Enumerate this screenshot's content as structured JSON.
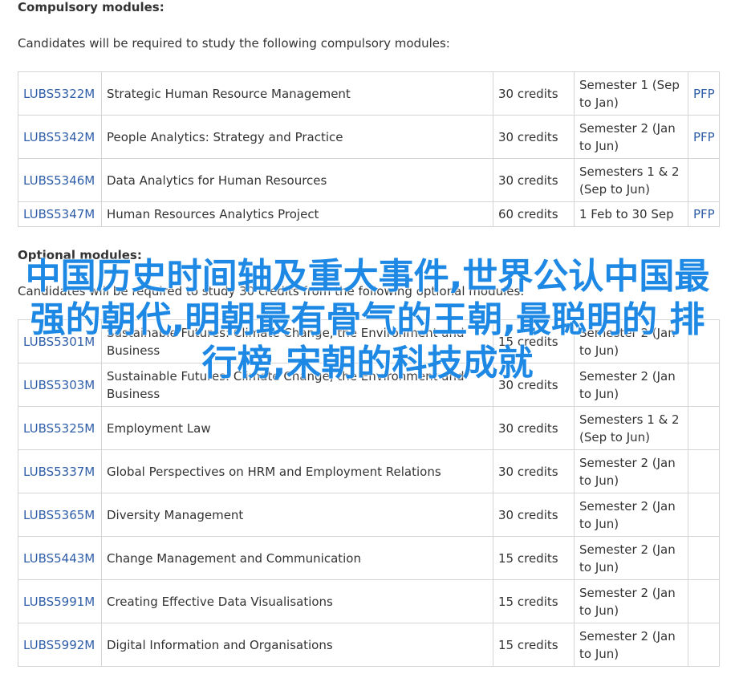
{
  "compulsory": {
    "heading": "Compulsory modules:",
    "intro": "Candidates will be required to study the following compulsory modules:",
    "rows": [
      {
        "code": "LUBS5322M",
        "title": "Strategic Human Resource Management",
        "credits": "30 credits",
        "semester": "Semester 1 (Sep to Jan)",
        "pfp": "PFP"
      },
      {
        "code": "LUBS5342M",
        "title": "People Analytics: Strategy and Practice",
        "credits": "30 credits",
        "semester": "Semester 2 (Jan to Jun)",
        "pfp": "PFP"
      },
      {
        "code": "LUBS5346M",
        "title": "Data Analytics for Human Resources",
        "credits": "30 credits",
        "semester": "Semesters 1 & 2 (Sep to Jun)",
        "pfp": ""
      },
      {
        "code": "LUBS5347M",
        "title": "Human Resources Analytics Project",
        "credits": "60 credits",
        "semester": "1 Feb to 30 Sep",
        "pfp": "PFP"
      }
    ]
  },
  "optional": {
    "heading": "Optional modules:",
    "intro": "Candidates will be required to study 30 credits from the following optional modules:",
    "rows": [
      {
        "code": "LUBS5301M",
        "title": "Sustainable Futures: Climate Change, the Environment and Business",
        "credits": "15 credits",
        "semester": "Semester 2 (Jan to Jun)"
      },
      {
        "code": "LUBS5303M",
        "title": "Sustainable Futures: Climate Change, the Environment and Business",
        "credits": "30 credits",
        "semester": "Semester 2 (Jan to Jun)"
      },
      {
        "code": "LUBS5325M",
        "title": "Employment Law",
        "credits": "30 credits",
        "semester": "Semesters 1 & 2 (Sep to Jun)"
      },
      {
        "code": "LUBS5337M",
        "title": "Global Perspectives on HRM and Employment Relations",
        "credits": "30 credits",
        "semester": "Semester 2 (Jan to Jun)"
      },
      {
        "code": "LUBS5365M",
        "title": "Diversity Management",
        "credits": "30 credits",
        "semester": "Semester 2 (Jan to Jun)"
      },
      {
        "code": "LUBS5443M",
        "title": "Change Management and Communication",
        "credits": "15 credits",
        "semester": "Semester 2 (Jan to Jun)"
      },
      {
        "code": "LUBS5991M",
        "title": "Creating Effective Data Visualisations",
        "credits": "15 credits",
        "semester": "Semester 2 (Jan to Jun)"
      },
      {
        "code": "LUBS5992M",
        "title": "Digital Information and Organisations",
        "credits": "15 credits",
        "semester": "Semester 2 (Jan to Jun)"
      }
    ]
  },
  "overlay_text": "中国历史时间轴及重大事件,世界公认中国最强的朝代,明朝最有骨气的王朝,最聪明的 排行榜,宋朝的科技成就",
  "colors": {
    "link": "#2f5ea8",
    "overlay": "#1e88e5",
    "border": "#d4d4d4"
  }
}
